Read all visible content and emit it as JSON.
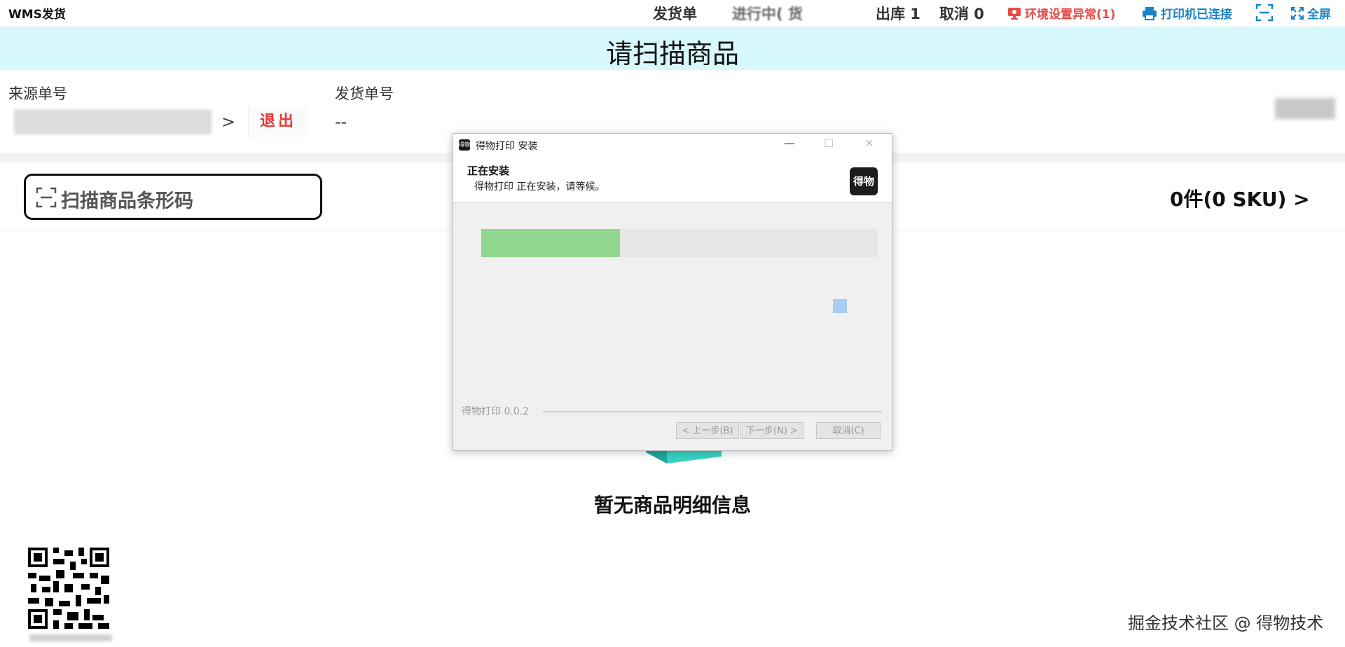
{
  "header": {
    "app_title": "WMS发货",
    "nav_ship_order": "发货单",
    "nav_in_progress": "进行中(  货",
    "nav_outbound": "出库 1",
    "nav_cancel": "取消 0",
    "env_status": "环境设置异常(1)",
    "printer_status": "打印机已连接",
    "fullscreen": "全屏",
    "colors": {
      "alert": "#e84a4a",
      "link": "#1a84c7"
    }
  },
  "banner": {
    "text": "请扫描商品",
    "color": "#d7f8fc"
  },
  "info": {
    "source_label": "来源单号",
    "source_arrow": ">",
    "exit_label": "退出",
    "ship_label": "发货单号",
    "ship_value": "--"
  },
  "scan": {
    "placeholder": "扫描商品条形码",
    "count": "0件(0 SKU) >"
  },
  "empty": {
    "text": "暂无商品明细信息"
  },
  "watermark": "掘金技术社区 @ 得物技术",
  "installer": {
    "icon_text": "得物",
    "title": "得物打印 安装",
    "heading": "正在安装",
    "subtitle": "得物打印 正在安装，请等候。",
    "logo_text": "得物",
    "progress": 0.35,
    "progress_color": "#8fd68f",
    "footer_brand": "得物打印 0.0.2",
    "back_button": "< 上一步(B)",
    "next_button": "下一步(N) >",
    "cancel_button": "取消(C)",
    "minimize": "—",
    "maximize": "☐",
    "close": "✕"
  }
}
